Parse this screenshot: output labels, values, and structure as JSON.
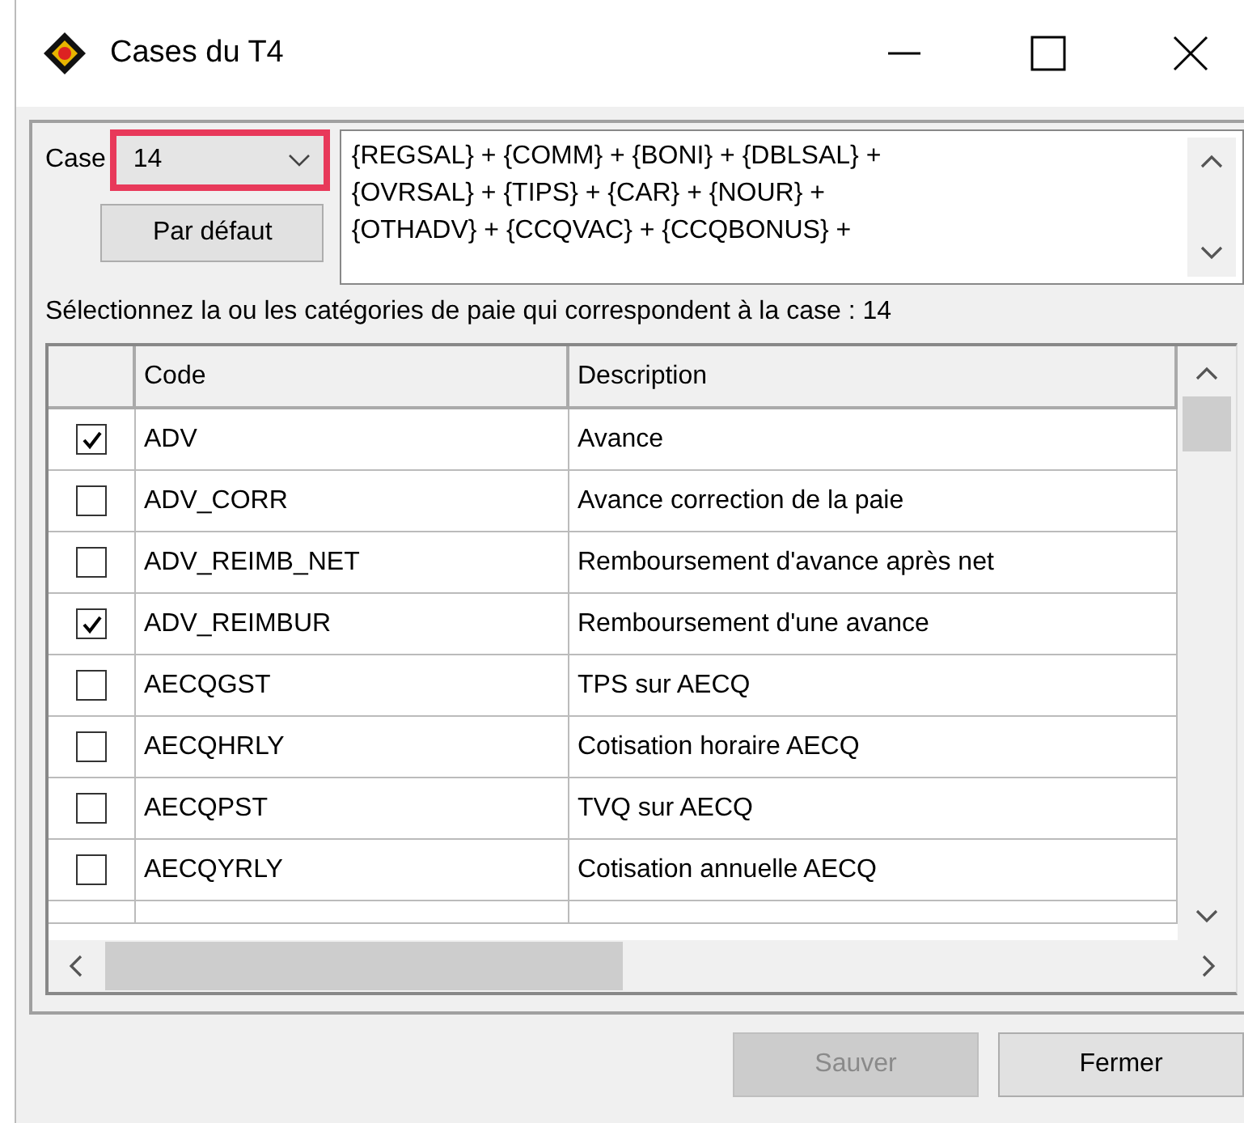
{
  "window": {
    "title": "Cases du T4"
  },
  "case": {
    "label": "Case",
    "value": "14",
    "highlighted": true
  },
  "default_button": {
    "label": "Par défaut"
  },
  "formula": "{REGSAL} + {COMM} + {BONI} + {DBLSAL} +\n{OVRSAL} + {TIPS} + {CAR} + {NOUR} +\n{OTHADV} + {CCQVAC} + {CCQBONUS} +",
  "instruction": "Sélectionnez la ou les catégories de paie qui correspondent à la case : 14",
  "table": {
    "columns": [
      "Code",
      "Description"
    ],
    "rows": [
      {
        "checked": true,
        "code": "ADV",
        "description": "Avance"
      },
      {
        "checked": false,
        "code": "ADV_CORR",
        "description": "Avance correction de la paie"
      },
      {
        "checked": false,
        "code": "ADV_REIMB_NET",
        "description": "Remboursement d'avance après net"
      },
      {
        "checked": true,
        "code": "ADV_REIMBUR",
        "description": "Remboursement d'une avance"
      },
      {
        "checked": false,
        "code": "AECQGST",
        "description": "TPS sur AECQ"
      },
      {
        "checked": false,
        "code": "AECQHRLY",
        "description": "Cotisation horaire AECQ"
      },
      {
        "checked": false,
        "code": "AECQPST",
        "description": "TVQ sur AECQ"
      },
      {
        "checked": false,
        "code": "AECQYRLY",
        "description": "Cotisation annuelle AECQ"
      }
    ]
  },
  "buttons": [
    {
      "label": "Sauver",
      "disabled": true
    },
    {
      "label": "Fermer",
      "disabled": false
    }
  ]
}
